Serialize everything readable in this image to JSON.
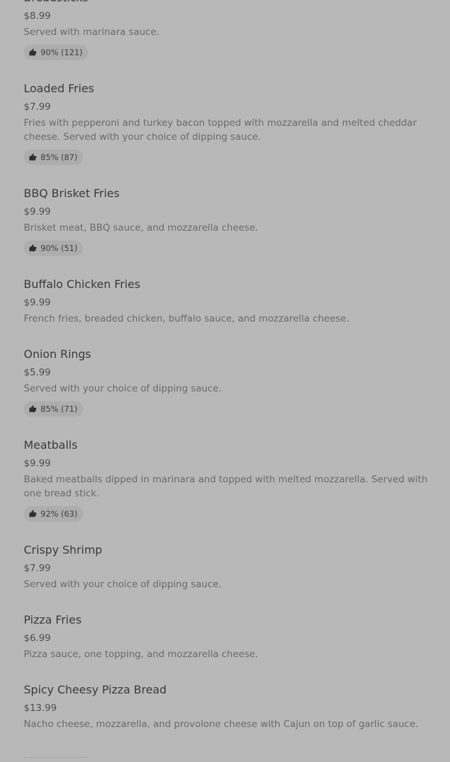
{
  "menu": {
    "items": [
      {
        "name": "Breadsticks",
        "price": "$8.99",
        "description": "Served with marinara sauce.",
        "rating": "90% (121)"
      },
      {
        "name": "Loaded Fries",
        "price": "$7.99",
        "description": "Fries with pepperoni and turkey bacon topped with mozzarella and melted cheddar cheese. Served with your choice of dipping sauce.",
        "rating": "85% (87)"
      },
      {
        "name": "BBQ Brisket Fries",
        "price": "$9.99",
        "description": "Brisket meat, BBQ sauce, and mozzarella cheese.",
        "rating": "90% (51)"
      },
      {
        "name": "Buffalo Chicken Fries",
        "price": "$9.99",
        "description": "French fries, breaded chicken, buffalo sauce, and mozzarella cheese.",
        "rating": ""
      },
      {
        "name": "Onion Rings",
        "price": "$5.99",
        "description": "Served with your choice of dipping sauce.",
        "rating": "85% (71)"
      },
      {
        "name": "Meatballs",
        "price": "$9.99",
        "description": "Baked meatballs dipped in marinara and topped with melted mozzarella. Served with one bread stick.",
        "rating": "92% (63)"
      },
      {
        "name": "Crispy Shrimp",
        "price": "$7.99",
        "description": "Served with your choice of dipping sauce.",
        "rating": ""
      },
      {
        "name": "Pizza Fries",
        "price": "$6.99",
        "description": "Pizza sauce, one topping, and mozzarella cheese.",
        "rating": ""
      },
      {
        "name": "Spicy Cheesy Pizza Bread",
        "price": "$13.99",
        "description": "Nacho cheese, mozzarella, and provolone cheese with Cajun on top of garlic sauce.",
        "rating": ""
      }
    ]
  },
  "icons": {
    "rating": "thumbs-up-icon"
  },
  "colors": {
    "background": "#b8b8b8",
    "badge": "#adadad",
    "title": "#3a3a3a",
    "description": "#6a6a6a"
  }
}
